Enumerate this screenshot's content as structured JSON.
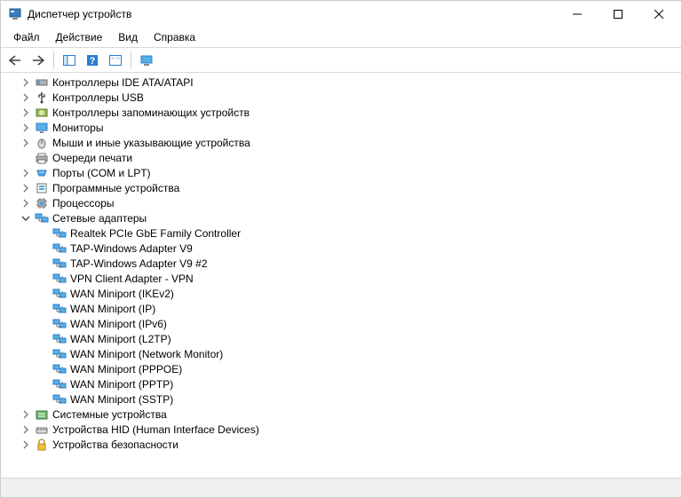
{
  "window": {
    "title": "Диспетчер устройств"
  },
  "menu": {
    "file": "Файл",
    "action": "Действие",
    "view": "Вид",
    "help": "Справка"
  },
  "tree": {
    "categories": [
      {
        "label": "Контроллеры IDE ATA/ATAPI",
        "icon": "ide",
        "expanded": false,
        "hasChildren": true,
        "children": []
      },
      {
        "label": "Контроллеры USB",
        "icon": "usb",
        "expanded": false,
        "hasChildren": true,
        "children": []
      },
      {
        "label": "Контроллеры запоминающих устройств",
        "icon": "storage",
        "expanded": false,
        "hasChildren": true,
        "children": []
      },
      {
        "label": "Мониторы",
        "icon": "monitor",
        "expanded": false,
        "hasChildren": true,
        "children": []
      },
      {
        "label": "Мыши и иные указывающие устройства",
        "icon": "mouse",
        "expanded": false,
        "hasChildren": true,
        "children": []
      },
      {
        "label": "Очереди печати",
        "icon": "printer",
        "expanded": false,
        "hasChildren": false,
        "children": []
      },
      {
        "label": "Порты (COM и LPT)",
        "icon": "port",
        "expanded": false,
        "hasChildren": true,
        "children": []
      },
      {
        "label": "Программные устройства",
        "icon": "software",
        "expanded": false,
        "hasChildren": true,
        "children": []
      },
      {
        "label": "Процессоры",
        "icon": "cpu",
        "expanded": false,
        "hasChildren": true,
        "children": []
      },
      {
        "label": "Сетевые адаптеры",
        "icon": "network",
        "expanded": true,
        "hasChildren": true,
        "children": [
          {
            "label": "Realtek PCIe GbE Family Controller",
            "icon": "network"
          },
          {
            "label": "TAP-Windows Adapter V9",
            "icon": "network"
          },
          {
            "label": "TAP-Windows Adapter V9 #2",
            "icon": "network"
          },
          {
            "label": "VPN Client Adapter - VPN",
            "icon": "network"
          },
          {
            "label": "WAN Miniport (IKEv2)",
            "icon": "network"
          },
          {
            "label": "WAN Miniport (IP)",
            "icon": "network"
          },
          {
            "label": "WAN Miniport (IPv6)",
            "icon": "network"
          },
          {
            "label": "WAN Miniport (L2TP)",
            "icon": "network"
          },
          {
            "label": "WAN Miniport (Network Monitor)",
            "icon": "network"
          },
          {
            "label": "WAN Miniport (PPPOE)",
            "icon": "network"
          },
          {
            "label": "WAN Miniport (PPTP)",
            "icon": "network"
          },
          {
            "label": "WAN Miniport (SSTP)",
            "icon": "network"
          }
        ]
      },
      {
        "label": "Системные устройства",
        "icon": "system",
        "expanded": false,
        "hasChildren": true,
        "children": []
      },
      {
        "label": "Устройства HID (Human Interface Devices)",
        "icon": "hid",
        "expanded": false,
        "hasChildren": true,
        "children": []
      },
      {
        "label": "Устройства безопасности",
        "icon": "security",
        "expanded": false,
        "hasChildren": true,
        "children": []
      }
    ]
  }
}
